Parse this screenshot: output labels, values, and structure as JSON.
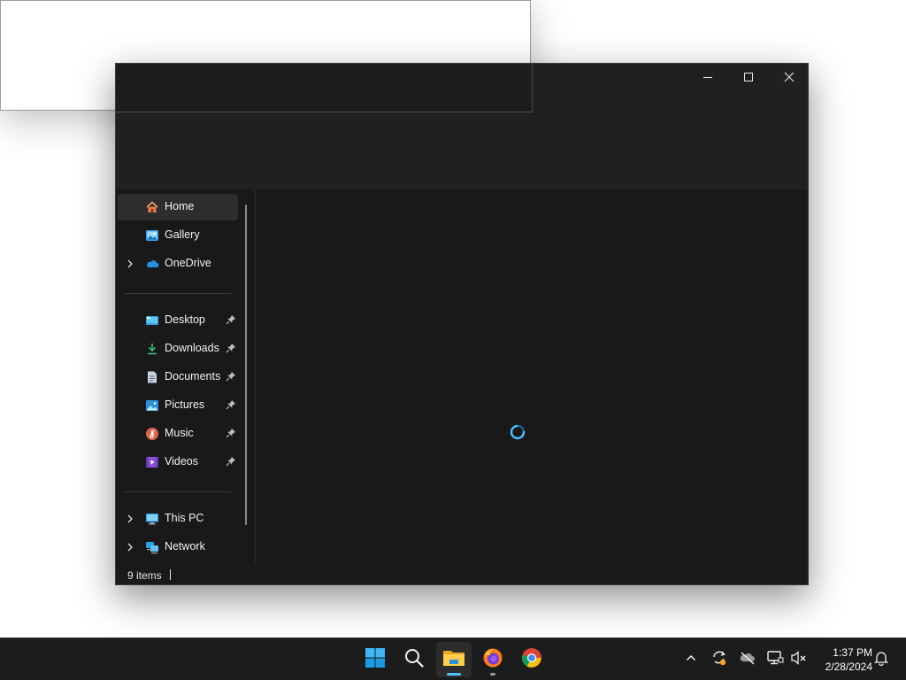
{
  "window": {
    "controls": {
      "minimize_icon": "minimize-icon",
      "maximize_icon": "maximize-icon",
      "close_icon": "close-icon"
    }
  },
  "sidebar": {
    "items": [
      {
        "label": "Home",
        "icon": "home-icon",
        "selected": true,
        "expandable": false,
        "pinned": false
      },
      {
        "label": "Gallery",
        "icon": "gallery-icon",
        "selected": false,
        "expandable": false,
        "pinned": false
      },
      {
        "label": "OneDrive",
        "icon": "onedrive-cloud-icon",
        "selected": false,
        "expandable": true,
        "pinned": false
      },
      {
        "label": "Desktop",
        "icon": "desktop-folder-icon",
        "selected": false,
        "expandable": false,
        "pinned": true
      },
      {
        "label": "Downloads",
        "icon": "downloads-icon",
        "selected": false,
        "expandable": false,
        "pinned": true
      },
      {
        "label": "Documents",
        "icon": "documents-icon",
        "selected": false,
        "expandable": false,
        "pinned": true
      },
      {
        "label": "Pictures",
        "icon": "pictures-icon",
        "selected": false,
        "expandable": false,
        "pinned": true
      },
      {
        "label": "Music",
        "icon": "music-icon",
        "selected": false,
        "expandable": false,
        "pinned": true
      },
      {
        "label": "Videos",
        "icon": "videos-icon",
        "selected": false,
        "expandable": false,
        "pinned": true
      },
      {
        "label": "This PC",
        "icon": "this-pc-icon",
        "selected": false,
        "expandable": true,
        "pinned": false
      },
      {
        "label": "Network",
        "icon": "network-icon",
        "selected": false,
        "expandable": true,
        "pinned": false
      }
    ]
  },
  "content": {
    "state": "loading",
    "indicator_icon": "loading-spinner-icon"
  },
  "statusbar": {
    "item_count": "9 items"
  },
  "taskbar": {
    "apps": [
      {
        "name": "Start",
        "icon": "windows-start-icon"
      },
      {
        "name": "Search",
        "icon": "search-icon"
      },
      {
        "name": "File Explorer",
        "icon": "file-explorer-icon",
        "active": true
      },
      {
        "name": "Firefox",
        "icon": "firefox-icon",
        "running": true
      },
      {
        "name": "Chrome",
        "icon": "chrome-icon"
      }
    ],
    "tray": [
      "chevron-up-icon",
      "sync-icon",
      "onedrive-offline-icon",
      "network-icon",
      "volume-muted-icon"
    ],
    "clock": {
      "time": "1:37 PM",
      "date": "2/28/2024"
    },
    "notifications_icon": "bell-icon"
  },
  "colors": {
    "accent": "#4cc2ff",
    "window_bg": "#191919",
    "titlebar_bg": "#202020",
    "taskbar_bg": "#1c1c1c"
  }
}
